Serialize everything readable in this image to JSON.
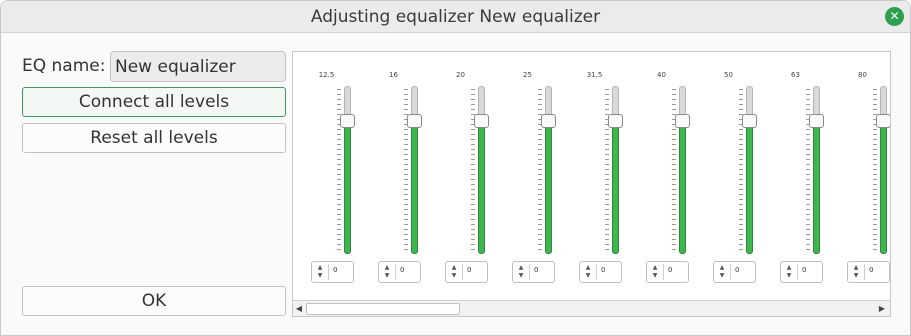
{
  "window": {
    "title": "Adjusting equalizer New equalizer"
  },
  "form": {
    "eq_name_label": "EQ name:",
    "eq_name_value": "New equalizer"
  },
  "buttons": {
    "connect": "Connect all levels",
    "reset": "Reset all levels",
    "ok": "OK"
  },
  "icons": {
    "close": "close-icon"
  },
  "accent_color": "#3fb54f",
  "bands": [
    {
      "label": "12.5",
      "value": "0",
      "level": 0.82
    },
    {
      "label": "16",
      "value": "0",
      "level": 0.82
    },
    {
      "label": "20",
      "value": "0",
      "level": 0.82
    },
    {
      "label": "25",
      "value": "0",
      "level": 0.82
    },
    {
      "label": "31.5",
      "value": "0",
      "level": 0.82
    },
    {
      "label": "40",
      "value": "0",
      "level": 0.82
    },
    {
      "label": "50",
      "value": "0",
      "level": 0.82
    },
    {
      "label": "63",
      "value": "0",
      "level": 0.82
    },
    {
      "label": "80",
      "value": "0",
      "level": 0.82
    }
  ]
}
